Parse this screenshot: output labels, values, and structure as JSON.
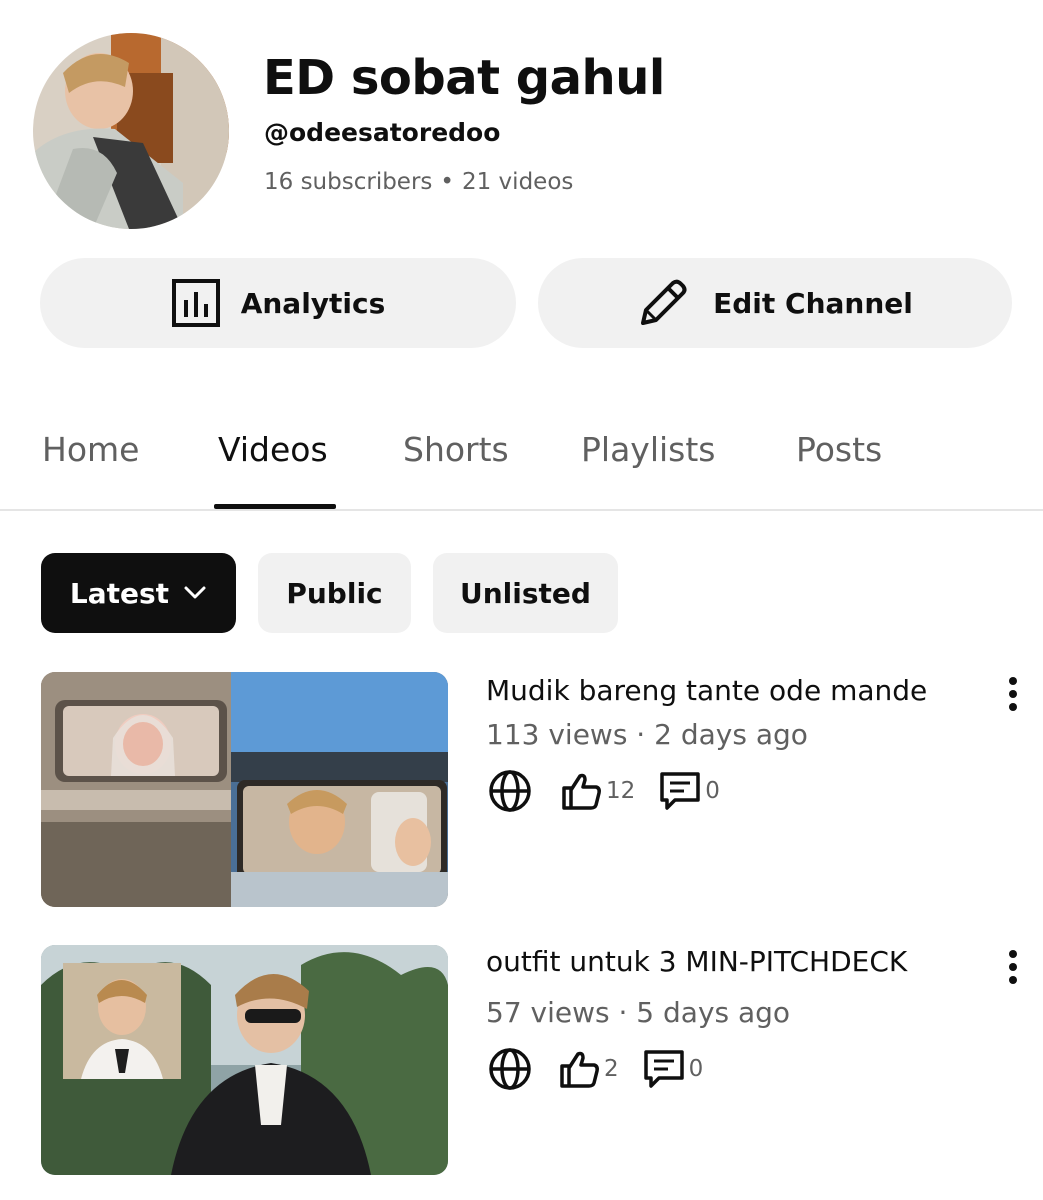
{
  "channel": {
    "name": "ED sobat gahul",
    "handle": "@odeesatoredoo",
    "subscribers": "16 subscribers",
    "separator": "•",
    "videos": "21 videos"
  },
  "actions": {
    "analytics_label": "Analytics",
    "edit_label": "Edit Channel"
  },
  "tabs": [
    {
      "label": "Home"
    },
    {
      "label": "Videos",
      "active": true
    },
    {
      "label": "Shorts"
    },
    {
      "label": "Playlists"
    },
    {
      "label": "Posts"
    }
  ],
  "filters": {
    "latest": "Latest",
    "public": "Public",
    "unlisted": "Unlisted"
  },
  "videos": [
    {
      "title": "Mudik bareng tante ode mande",
      "views": "113 views",
      "age": "2 days ago",
      "meta": "113 views · 2 days ago",
      "likes": "12",
      "comments": "0"
    },
    {
      "title": "outfit untuk 3 MIN-PITCHDECK",
      "views": "57 views",
      "age": "5 days ago",
      "meta": "57 views · 5 days ago",
      "likes": "2",
      "comments": "0"
    }
  ],
  "icons": {
    "analytics": "bar-chart-icon",
    "edit": "pencil-icon",
    "dropdown": "chevron-down-icon",
    "visibility": "globe-icon",
    "likes": "thumbs-up-icon",
    "comments": "comment-icon",
    "menu": "more-vertical-icon"
  }
}
